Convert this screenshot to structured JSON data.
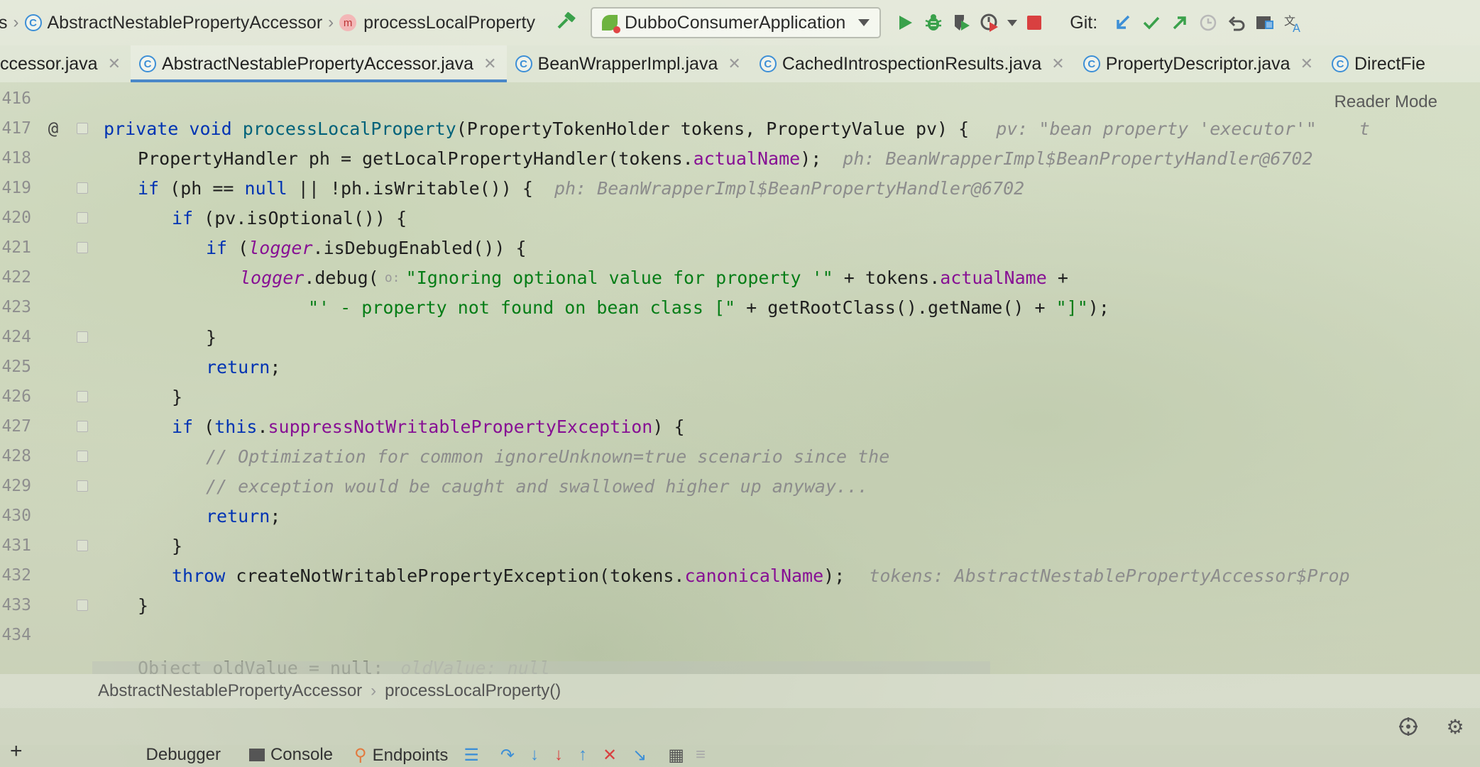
{
  "navbar": {
    "crumbs": [
      "s",
      "AbstractNestablePropertyAccessor",
      "processLocalProperty"
    ],
    "run_config": "DubboConsumerApplication",
    "git_label": "Git:",
    "icons": [
      "hammer-icon",
      "run-icon",
      "debug-icon",
      "coverage-icon",
      "profile-icon",
      "stop-icon",
      "git-update-icon",
      "git-commit-icon",
      "git-push-icon",
      "history-icon",
      "rollback-icon",
      "project-structure-icon",
      "translate-icon"
    ]
  },
  "tabs": [
    {
      "label": "ccessor.java",
      "active": false
    },
    {
      "label": "AbstractNestablePropertyAccessor.java",
      "active": true
    },
    {
      "label": "BeanWrapperImpl.java",
      "active": false
    },
    {
      "label": "CachedIntrospectionResults.java",
      "active": false
    },
    {
      "label": "PropertyDescriptor.java",
      "active": false
    },
    {
      "label": "DirectFie",
      "active": false
    }
  ],
  "editor": {
    "reader_mode": "Reader Mode",
    "line_numbers": [
      "416",
      "417",
      "418",
      "419",
      "420",
      "421",
      "422",
      "423",
      "424",
      "425",
      "426",
      "427",
      "428",
      "429",
      "430",
      "431",
      "432",
      "433",
      "434"
    ],
    "gutter_at": "@",
    "lines": {
      "l417": {
        "kw1": "private",
        "kw2": "void",
        "fn": "processLocalProperty",
        "rest": "(PropertyTokenHolder tokens, PropertyValue pv) {",
        "hint": "pv: \"bean property 'executor'\"",
        "hint2": "t"
      },
      "l418": {
        "pre": "PropertyHandler ph = getLocalPropertyHandler(tokens.",
        "field": "actualName",
        "post": ");",
        "hint": "ph: BeanWrapperImpl$BeanPropertyHandler@6702"
      },
      "l419": {
        "kw": "if",
        "a": " (ph == ",
        "kw2": "null",
        "b": " || !ph.isWritable()) {",
        "hint": "ph: BeanWrapperImpl$BeanPropertyHandler@6702"
      },
      "l420": {
        "kw": "if",
        "rest": " (pv.isOptional()) {"
      },
      "l421": {
        "kw": "if",
        "a": " (",
        "static": "logger",
        "b": ".isDebugEnabled()) {"
      },
      "l422": {
        "static": "logger",
        "a": ".debug(",
        "inlay": "o:",
        "str": "\"Ignoring optional value for property '\"",
        "b": " + tokens.",
        "field": "actualName",
        "c": " +"
      },
      "l423": {
        "str": "\"' - property not found on bean class [\"",
        "a": " + getRootClass().getName() + ",
        "str2": "\"]\"",
        "b": ");"
      },
      "l424": {
        "text": "}"
      },
      "l425": {
        "kw": "return",
        "text": ";"
      },
      "l426": {
        "text": "}"
      },
      "l427": {
        "kw": "if",
        "a": " (",
        "kw2": "this",
        "b": ".",
        "field": "suppressNotWritablePropertyException",
        "c": ") {"
      },
      "l428": {
        "cmt": "// Optimization for common ignoreUnknown=true scenario since the"
      },
      "l429": {
        "cmt": "// exception would be caught and swallowed higher up anyway..."
      },
      "l430": {
        "kw": "return",
        "text": ";"
      },
      "l431": {
        "text": "}"
      },
      "l432": {
        "kw": "throw",
        "a": " createNotWritablePropertyException(tokens.",
        "field": "canonicalName",
        "b": ");",
        "hint": "tokens: AbstractNestablePropertyAccessor$Prop"
      },
      "l433": {
        "text": "}"
      },
      "l435": {
        "text": "Object oldValue = null;",
        "hint": "oldValue: null"
      }
    }
  },
  "breadcrumb": {
    "class": "AbstractNestablePropertyAccessor",
    "method": "processLocalProperty()"
  },
  "bottom": {
    "tabs": [
      "Debugger",
      "Console",
      "Endpoints"
    ],
    "icons": [
      "add-icon",
      "target-icon",
      "settings-icon",
      "threads-icon",
      "step-over-icon",
      "step-into-icon",
      "force-step-into-icon",
      "step-out-icon",
      "drop-frame-icon",
      "run-to-cursor-icon",
      "evaluate-icon",
      "trace-icon"
    ]
  },
  "colors": {
    "keyword": "#0033b3",
    "method": "#00627a",
    "field": "#871094",
    "string": "#067d17",
    "comment": "#8c8c8c",
    "active_tab_underline": "#4a87c8",
    "run_green": "#3aa14b",
    "stop_red": "#d94040"
  }
}
